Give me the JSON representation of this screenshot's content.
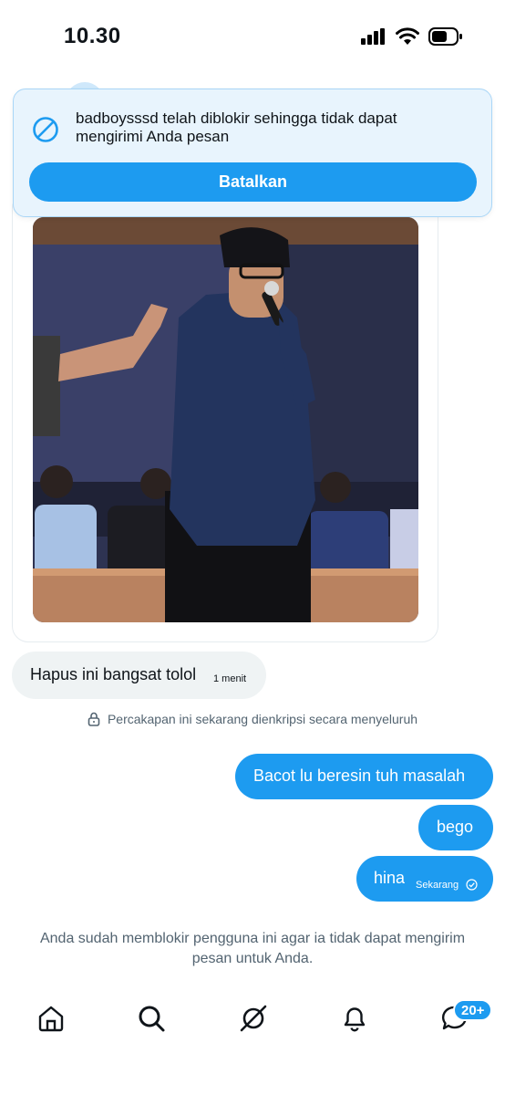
{
  "status_bar": {
    "time": "10.30"
  },
  "banner": {
    "message": "badboysssd telah diblokir sehingga tidak dapat mengirimi Anda pesan",
    "button_label": "Batalkan",
    "icon": "blocked-icon"
  },
  "messages": {
    "received": {
      "text": "Hapus ini bangsat tolol",
      "time": "1 menit"
    },
    "encryption_notice": "Percakapan ini sekarang dienkripsi secara menyeluruh",
    "sent": [
      {
        "text": "Bacot lu beresin tuh masalah"
      },
      {
        "text": "bego"
      },
      {
        "text": "hina",
        "time": "Sekarang"
      }
    ]
  },
  "blocked_notice": "Anda sudah memblokir pengguna ini agar ia tidak dapat mengirim pesan untuk Anda.",
  "nav": {
    "items": [
      "home-icon",
      "search-icon",
      "grok-icon",
      "notifications-icon",
      "messages-icon"
    ],
    "messages_badge": "20+"
  },
  "colors": {
    "accent": "#1d9bf0",
    "banner_bg": "#e8f4fd",
    "received_bg": "#eff3f4",
    "muted": "#536471"
  }
}
